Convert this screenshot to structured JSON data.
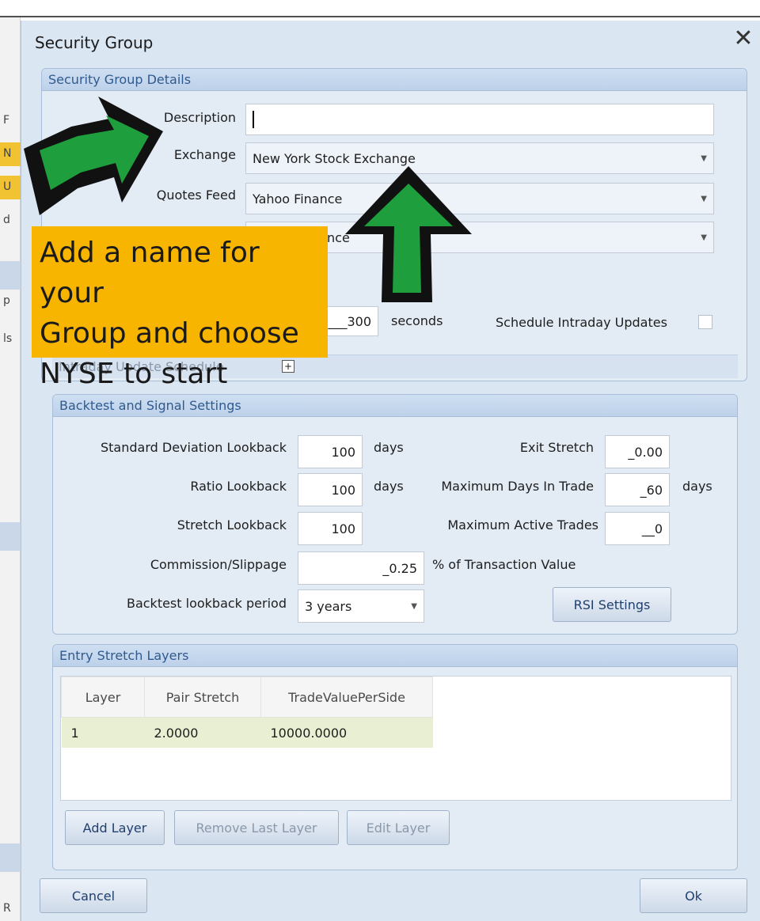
{
  "background_window": {
    "fragments": [
      "F",
      "N",
      "U",
      "d",
      "p",
      "ls",
      "R"
    ]
  },
  "dialog": {
    "title": "Security Group",
    "close_glyph": "✕"
  },
  "details": {
    "header": "Security Group Details",
    "description_label": "Description",
    "description_value": "",
    "exchange_label": "Exchange",
    "exchange_value": "New York Stock Exchange",
    "quotes_feed_label": "Quotes Feed",
    "quotes_feed_value": "Yahoo Finance",
    "history_feed_value_visible": "nce",
    "interval_value": "___300",
    "interval_unit": "seconds",
    "schedule_label": "Schedule Intraday Updates",
    "schedule_checked": false,
    "intraday_schedule_label": "Intraday Update Schedule",
    "intraday_expand_glyph": "+"
  },
  "annotation": {
    "callout_lines": [
      "Add a name for your",
      "Group and choose",
      "NYSE to start"
    ],
    "arrow_color": "#1e9e3c",
    "callout_color": "#f7b500"
  },
  "backtest": {
    "header": "Backtest and Signal Settings",
    "std_dev_label": "Standard Deviation Lookback",
    "std_dev_value": "100",
    "ratio_label": "Ratio Lookback",
    "ratio_value": "100",
    "stretch_label": "Stretch Lookback",
    "stretch_value": "100",
    "days_unit": "days",
    "exit_stretch_label": "Exit Stretch",
    "exit_stretch_value": "_0.00",
    "max_days_label": "Maximum Days In Trade",
    "max_days_value": "_60",
    "max_active_label": "Maximum Active Trades",
    "max_active_value": "__0",
    "commission_label": "Commission/Slippage",
    "commission_value": "_0.25",
    "commission_unit": "% of Transaction Value",
    "backtest_period_label": "Backtest lookback period",
    "backtest_period_value": "3 years",
    "rsi_button": "RSI Settings"
  },
  "entry_layers": {
    "header": "Entry Stretch Layers",
    "columns": [
      "Layer",
      "Pair Stretch",
      "TradeValuePerSide"
    ],
    "rows": [
      [
        "1",
        "2.0000",
        "10000.0000"
      ]
    ],
    "add_button": "Add Layer",
    "remove_button": "Remove Last Layer",
    "edit_button": "Edit Layer"
  },
  "footer": {
    "cancel_button": "Cancel",
    "ok_button": "Ok"
  }
}
